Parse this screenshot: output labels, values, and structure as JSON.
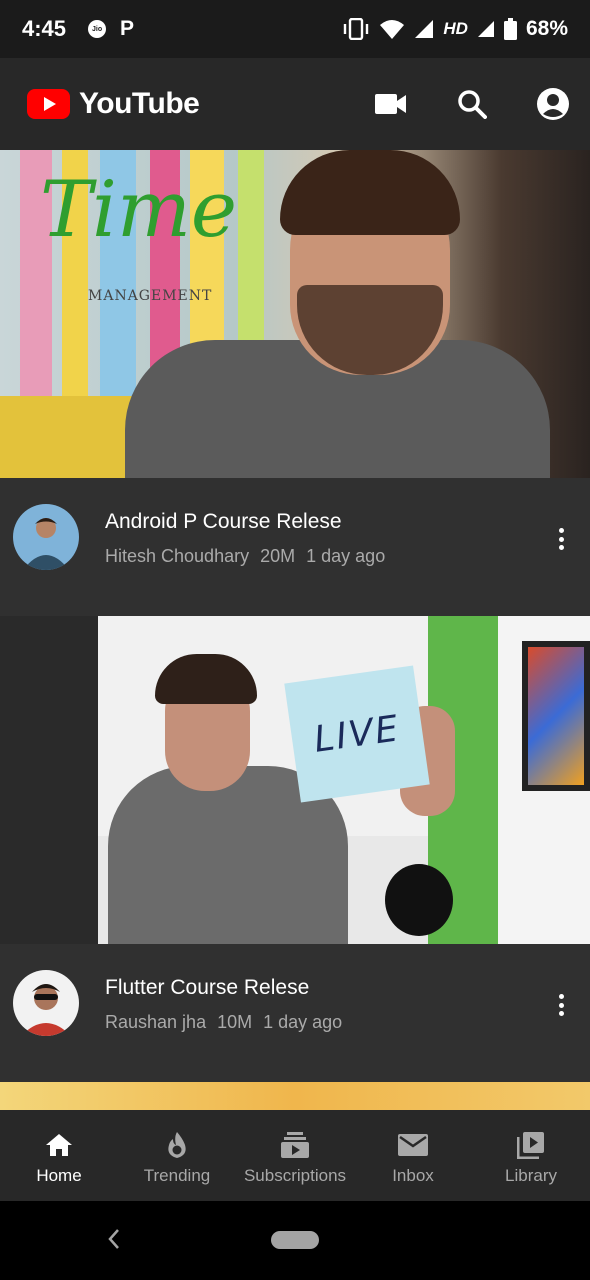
{
  "status_bar": {
    "time": "4:45",
    "carrier_icon": "jio-icon",
    "p_icon_label": "P",
    "network_label": "HD",
    "battery_percent": "68%"
  },
  "app_bar": {
    "logo_text": "YouTube",
    "actions": [
      "video-camera-icon",
      "search-icon",
      "account-icon"
    ]
  },
  "videos": [
    {
      "thumbnail_text": "Time",
      "thumbnail_subtext": "MANAGEMENT",
      "title": "Android P Course Relese",
      "channel": "Hitesh Choudhary",
      "views": "20M",
      "age": "1 day ago"
    },
    {
      "thumbnail_text": "LIVE",
      "title": "Flutter Course Relese",
      "channel": "Raushan jha",
      "views": "10M",
      "age": "1 day ago"
    }
  ],
  "bottom_nav": {
    "items": [
      {
        "label": "Home",
        "icon": "home-icon",
        "active": true
      },
      {
        "label": "Trending",
        "icon": "trending-icon",
        "active": false
      },
      {
        "label": "Subscriptions",
        "icon": "subscriptions-icon",
        "active": false
      },
      {
        "label": "Inbox",
        "icon": "inbox-icon",
        "active": false
      },
      {
        "label": "Library",
        "icon": "library-icon",
        "active": false
      }
    ]
  },
  "colors": {
    "brand_red": "#ff0000",
    "background": "#212121",
    "app_bar": "#282828",
    "card": "#303030",
    "secondary_text": "#aaaaaa"
  }
}
